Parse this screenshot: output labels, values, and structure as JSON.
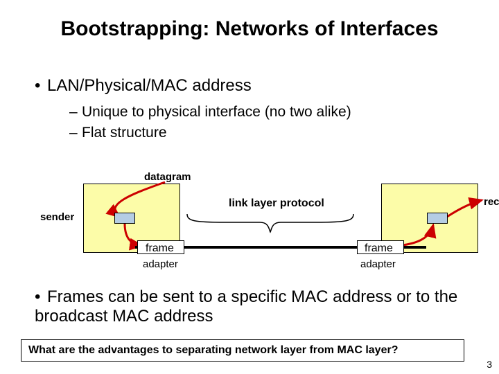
{
  "title": "Bootstrapping: Networks of Interfaces",
  "bullets": {
    "b1": "LAN/Physical/MAC address",
    "b1a": "Unique to physical interface (no two alike)",
    "b1b": "Flat structure",
    "b2": "Frames can be sent to a specific MAC address or to the broadcast MAC address"
  },
  "diagram": {
    "datagram": "datagram",
    "sender": "sender",
    "receiver": "receiver",
    "link_layer_protocol": "link layer protocol",
    "frame_left": "frame",
    "frame_right": "frame",
    "adapter_left": "adapter",
    "adapter_right": "adapter"
  },
  "callout": "What are the advantages to separating network layer from MAC layer?",
  "page_number": "3"
}
